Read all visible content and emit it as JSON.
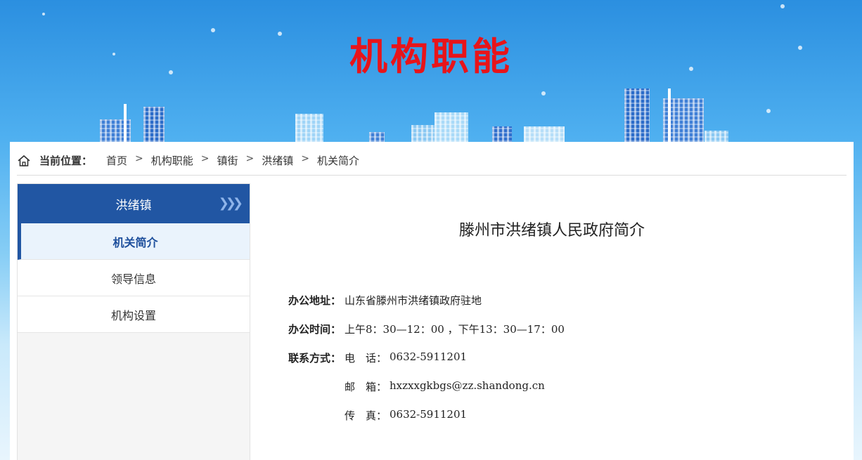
{
  "banner": {
    "title": "机构职能"
  },
  "breadcrumb": {
    "label": "当前位置：",
    "items": [
      "首页",
      "机构职能",
      "镇街",
      "洪绪镇",
      "机关简介"
    ],
    "separator": ">"
  },
  "sidebar": {
    "heading": "洪绪镇",
    "heading_chevrons": "❯❯❯",
    "items": [
      {
        "label": "机关简介"
      },
      {
        "label": "领导信息"
      },
      {
        "label": "机构设置"
      }
    ]
  },
  "article": {
    "title": "滕州市洪绪镇人民政府简介",
    "address_label": "办公地址：",
    "address_value": "山东省滕州市洪绪镇政府驻地",
    "hours_label": "办公时间：",
    "hours_value": "上午8：30—12：00 ，下午13：30—17：00",
    "contact_label": "联系方式：",
    "phone_label": "电　话：",
    "phone_value": "0632-5911201",
    "email_label": "邮　箱：",
    "email_value": "hxzxxgkbgs@zz.shandong.cn",
    "fax_label": "传　真：",
    "fax_value": "0632-5911201"
  },
  "colors": {
    "title_red": "#e8141a",
    "sidebar_blue": "#2156a3",
    "active_text": "#1e4f9c"
  }
}
